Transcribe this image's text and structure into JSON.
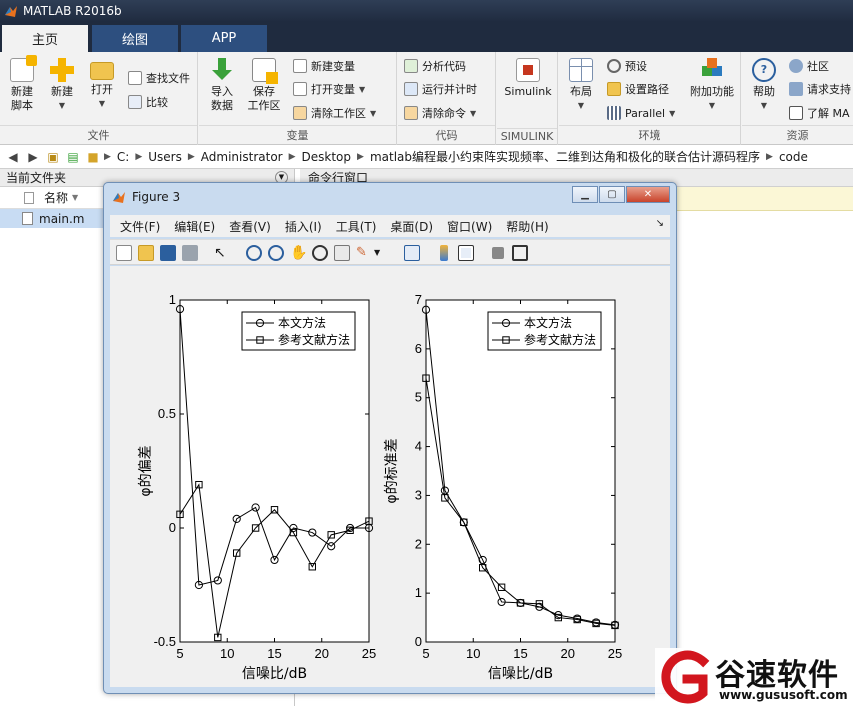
{
  "app": {
    "title": "MATLAB R2016b"
  },
  "tabs": [
    {
      "label": "主页",
      "active": true
    },
    {
      "label": "绘图",
      "active": false
    },
    {
      "label": "APP",
      "active": false
    }
  ],
  "ribbon": {
    "file": {
      "title": "文件",
      "new_script": "新建\n脚本",
      "new": "新建",
      "open": "打开",
      "find_files": "查找文件",
      "compare": "比较"
    },
    "variable": {
      "title": "变量",
      "import_data": "导入\n数据",
      "save_workspace": "保存\n工作区",
      "new_variable": "新建变量",
      "open_variable": "打开变量",
      "clear_workspace": "清除工作区"
    },
    "code": {
      "title": "代码",
      "analyze_code": "分析代码",
      "run_and_time": "运行并计时",
      "clear_commands": "清除命令"
    },
    "simulink": {
      "title": "SIMULINK",
      "simulink": "Simulink"
    },
    "environment": {
      "title": "环境",
      "layout": "布局",
      "preferences": "预设",
      "set_path": "设置路径",
      "parallel": "Parallel",
      "addons": "附加功能"
    },
    "resources": {
      "title": "资源",
      "help": "帮助",
      "community": "社区",
      "request_support": "请求支持",
      "learn_matlab": "了解 MA"
    }
  },
  "address": {
    "segments": [
      "C:",
      "Users",
      "Administrator",
      "Desktop",
      "matlab编程最小约束阵实现频率、二维到达角和极化的联合估计源码程序",
      "code"
    ]
  },
  "current_folder": {
    "title": "当前文件夹",
    "column_name": "名称",
    "files": [
      "main.m"
    ]
  },
  "command_window": {
    "title": "命令行窗口"
  },
  "figure": {
    "title": "Figure 3",
    "menu": [
      "文件(F)",
      "编辑(E)",
      "查看(V)",
      "插入(I)",
      "工具(T)",
      "桌面(D)",
      "窗口(W)",
      "帮助(H)"
    ]
  },
  "chart_data": [
    {
      "type": "line",
      "xlabel": "信噪比/dB",
      "ylabel": "φ的偏差",
      "xlim": [
        5,
        25
      ],
      "ylim": [
        -0.5,
        1
      ],
      "xticks": [
        5,
        10,
        15,
        20,
        25
      ],
      "yticks": [
        -0.5,
        0,
        0.5,
        1
      ],
      "ytick_labels": [
        "-0.5",
        "0",
        "0.5",
        "1"
      ],
      "legend": "top-right",
      "x": [
        5,
        7,
        9,
        11,
        13,
        15,
        17,
        19,
        21,
        23,
        25
      ],
      "series": [
        {
          "name": "本文方法",
          "marker": "circle",
          "values": [
            0.96,
            -0.25,
            -0.23,
            0.04,
            0.09,
            -0.14,
            0.0,
            -0.02,
            -0.08,
            0.0,
            0.0
          ]
        },
        {
          "name": "参考文献方法",
          "marker": "square",
          "values": [
            0.06,
            0.19,
            -0.48,
            -0.11,
            0.0,
            0.08,
            -0.02,
            -0.17,
            -0.03,
            -0.01,
            0.03
          ]
        }
      ]
    },
    {
      "type": "line",
      "xlabel": "信噪比/dB",
      "ylabel": "φ的标准差",
      "xlim": [
        5,
        25
      ],
      "ylim": [
        0,
        7
      ],
      "xticks": [
        5,
        10,
        15,
        20,
        25
      ],
      "yticks": [
        0,
        1,
        2,
        3,
        4,
        5,
        6,
        7
      ],
      "ytick_labels": [
        "0",
        "1",
        "2",
        "3",
        "4",
        "5",
        "6",
        "7"
      ],
      "legend": "top-right",
      "x": [
        5,
        7,
        9,
        11,
        13,
        15,
        17,
        19,
        21,
        23,
        25
      ],
      "series": [
        {
          "name": "本文方法",
          "marker": "circle",
          "values": [
            6.8,
            3.1,
            2.45,
            1.68,
            0.82,
            0.8,
            0.72,
            0.55,
            0.48,
            0.4,
            0.35
          ]
        },
        {
          "name": "参考文献方法",
          "marker": "square",
          "values": [
            5.4,
            2.95,
            2.45,
            1.52,
            1.12,
            0.8,
            0.78,
            0.5,
            0.46,
            0.38,
            0.34
          ]
        }
      ]
    }
  ],
  "watermark": {
    "brand": "谷速软件",
    "url": "www.gususoft.com",
    "brand_color": "#d2161e"
  },
  "colors": {
    "titlebar": "#1f2b3f",
    "tab_inactive": "#2d4f7f",
    "ribbon": "#f2f2f2",
    "selection": "#c8dcf3"
  }
}
